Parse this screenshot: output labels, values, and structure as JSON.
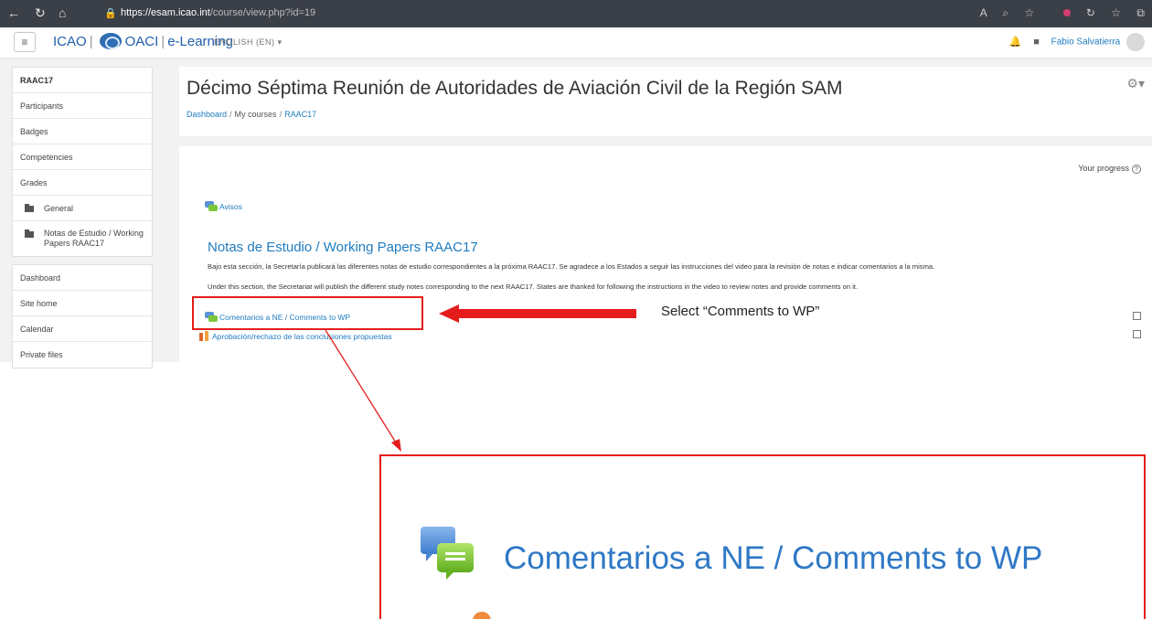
{
  "browser": {
    "url_host": "https://esam.icao.int",
    "url_path": "/course/view.php?id=19",
    "icons": [
      "back-icon",
      "refresh-icon",
      "home-icon",
      "lock-icon",
      "read-aloud-icon",
      "zoom-icon",
      "favorites-icon",
      "extension-icon",
      "settings-icon"
    ]
  },
  "header": {
    "menu_icon": "≡",
    "logo_icao": "ICAO",
    "logo_oaci": "OACI",
    "logo_elearning": "e-Learning",
    "language": "ENGLISH (EN) ▾",
    "user_name": "Fabio Salvatierra"
  },
  "sidebar": {
    "course_items": [
      {
        "label": "RAAC17"
      },
      {
        "label": "Participants"
      },
      {
        "label": "Badges"
      },
      {
        "label": "Competencies"
      },
      {
        "label": "Grades"
      },
      {
        "label": "General"
      },
      {
        "label": "Notas de Estudio / Working Papers RAAC17"
      }
    ],
    "site_items": [
      {
        "label": "Dashboard"
      },
      {
        "label": "Site home"
      },
      {
        "label": "Calendar"
      },
      {
        "label": "Private files"
      }
    ]
  },
  "course": {
    "title": "Décimo Séptima Reunión de Autoridades de Aviación Civil de la Región SAM",
    "breadcrumb": [
      "Dashboard",
      "My courses",
      "RAAC17"
    ],
    "progress_label": "Your progress",
    "avisos": "Avisos",
    "section_title": "Notas de Estudio / Working Papers RAAC17",
    "section_text_es": "Bajo esta sección, la Secretaría publicará las diferentes notas de estudio correspondientes a la próxima RAAC17. Se agradece a los Estados a seguir las instrucciones del video para la revisión de notas e indicar comentarios a la misma.",
    "section_text_en": "Under this section, the Secretariat will publish the different study notes corresponding to the next RAAC17. States are thanked for following the instructions in the video to review notes and provide comments on it.",
    "activity_comments": "Comentarios a NE / Comments to WP",
    "activity_vote": "Aprobación/rechazo de las conclusiones propuestas"
  },
  "annotation": {
    "label": "Select “Comments to WP”",
    "zoom_text": "Comentarios a NE / Comments to WP",
    "accent_color": "#e41c1c"
  }
}
